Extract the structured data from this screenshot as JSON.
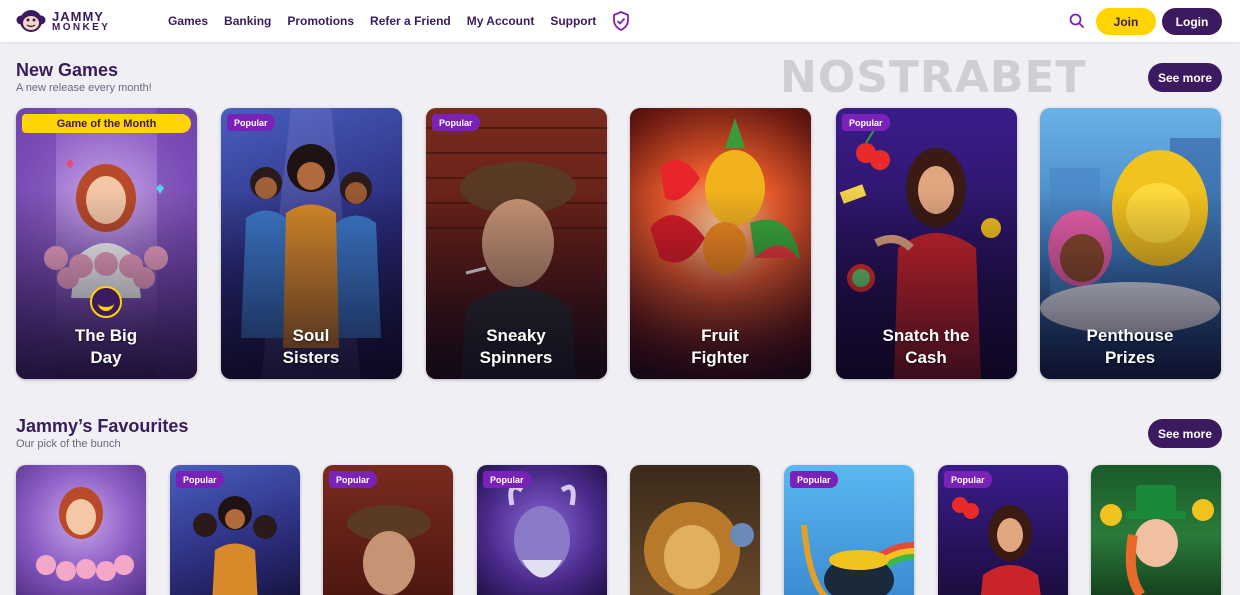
{
  "brand": {
    "line1": "JAMMY",
    "line2": "MONKEY"
  },
  "nav": [
    "Games",
    "Banking",
    "Promotions",
    "Refer a Friend",
    "My Account",
    "Support"
  ],
  "header": {
    "join": "Join",
    "login": "Login"
  },
  "watermark": "NOSTRABET",
  "new_games": {
    "title": "New Games",
    "subtitle": "A new release every month!",
    "see_more": "See more",
    "cards": [
      {
        "title": "The Big Day",
        "badge": "Game of the Month"
      },
      {
        "title": "Soul Sisters",
        "badge": "Popular"
      },
      {
        "title": "Sneaky Spinners",
        "badge": "Popular"
      },
      {
        "title": "Fruit Fighter",
        "badge": ""
      },
      {
        "title": "Snatch the Cash",
        "badge": "Popular"
      },
      {
        "title": "Penthouse Prizes",
        "badge": ""
      }
    ]
  },
  "favourites": {
    "title": "Jammy’s Favourites",
    "subtitle": "Our pick of the bunch",
    "see_more": "See more",
    "cards": [
      {
        "badge": ""
      },
      {
        "badge": "Popular"
      },
      {
        "badge": "Popular"
      },
      {
        "badge": "Popular"
      },
      {
        "badge": ""
      },
      {
        "badge": "Popular"
      },
      {
        "badge": "Popular"
      },
      {
        "badge": ""
      }
    ]
  },
  "colors": {
    "brand_purple": "#3b1a5f",
    "accent_yellow": "#ffd400",
    "badge_purple": "#7a22b8",
    "background": "#f0eff4"
  },
  "icons": [
    "monkey-logo-icon",
    "shield-check-icon",
    "search-icon",
    "banana-icon"
  ]
}
